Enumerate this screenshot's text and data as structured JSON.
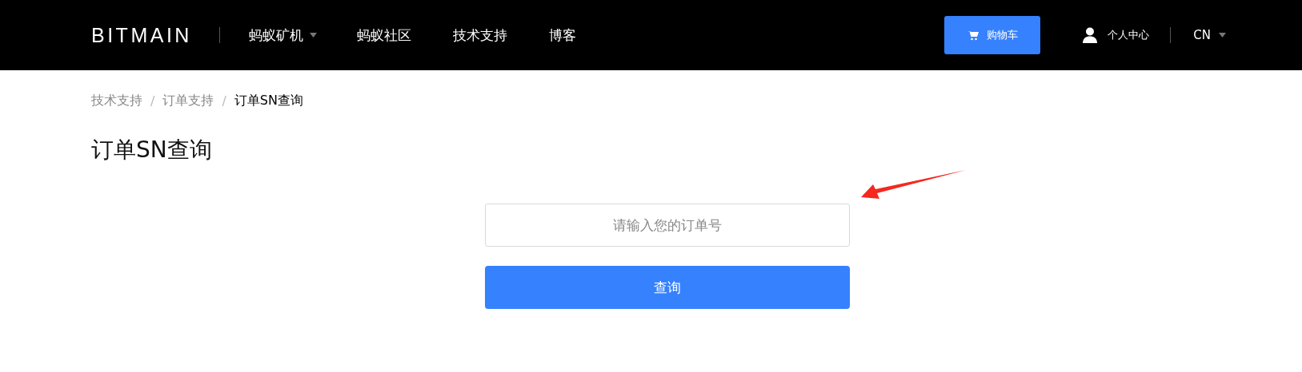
{
  "header": {
    "logo": "BITMAIN",
    "nav": [
      {
        "label": "蚂蚁矿机",
        "dropdown": true
      },
      {
        "label": "蚂蚁社区",
        "dropdown": false
      },
      {
        "label": "技术支持",
        "dropdown": false
      },
      {
        "label": "博客",
        "dropdown": false
      }
    ],
    "cart_button": "购物车",
    "account": "个人中心",
    "language": "CN"
  },
  "breadcrumb_separator": "/",
  "breadcrumb": [
    {
      "label": "技术支持",
      "current": false
    },
    {
      "label": "订单支持",
      "current": false
    },
    {
      "label": "订单SN查询",
      "current": true
    }
  ],
  "page_title": "订单SN查询",
  "form": {
    "placeholder": "请输入您的订单号",
    "submit": "查询"
  }
}
